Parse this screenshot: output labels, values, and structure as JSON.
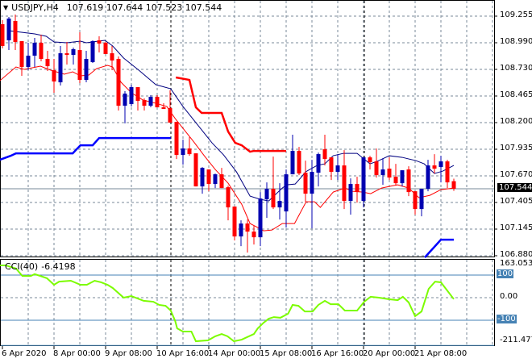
{
  "header": {
    "symbol": "USDJPY,H4",
    "ohlc": "107.619 107.644 107.523 107.544",
    "menu_icon": "triangle-down-icon"
  },
  "colors": {
    "bull": "#0000b0",
    "bear": "#ff0000",
    "ma_fast": "#ff0000",
    "ma_slow": "#000080",
    "cci": "#7cfc00",
    "level": "#4682b4",
    "grid": "#7a8a99"
  },
  "price_axis": {
    "ticks": [
      "109.255",
      "108.990",
      "108.730",
      "108.465",
      "108.200",
      "107.935",
      "107.670",
      "107.405",
      "107.145",
      "106.880"
    ],
    "current": "107.544"
  },
  "cci_panel": {
    "label": "CCI(40)",
    "value": "-6.4198",
    "max": "163.0533",
    "min": "-211.4777",
    "levels": [
      "100",
      "0.00",
      "-100"
    ]
  },
  "time_axis": {
    "labels": [
      "6 Apr 2020",
      "8 Apr 00:00",
      "9 Apr 08:00",
      "10 Apr 16:00",
      "14 Apr 00:00",
      "15 Apr 08:00",
      "16 Apr 16:00",
      "20 Apr 00:00",
      "21 Apr 08:00"
    ]
  },
  "chart_data": {
    "type": "candlestick",
    "symbol": "USDJPY",
    "timeframe": "H4",
    "ylim": [
      106.88,
      109.255
    ],
    "candles_ohlc": [
      [
        109.175,
        109.215,
        108.935,
        108.959
      ],
      [
        109.015,
        109.247,
        108.919,
        109.231
      ],
      [
        109.207,
        109.271,
        108.919,
        108.999
      ],
      [
        109.007,
        109.007,
        108.663,
        108.751
      ],
      [
        108.751,
        108.991,
        108.719,
        108.863
      ],
      [
        108.863,
        109.039,
        108.751,
        108.991
      ],
      [
        108.991,
        109.071,
        108.807,
        108.831
      ],
      [
        108.831,
        108.911,
        108.711,
        108.759
      ],
      [
        108.719,
        108.831,
        108.495,
        108.607
      ],
      [
        108.599,
        108.959,
        108.567,
        108.887
      ],
      [
        108.887,
        108.999,
        108.775,
        108.871
      ],
      [
        108.871,
        108.943,
        108.775,
        108.927
      ],
      [
        108.919,
        109.095,
        108.591,
        108.623
      ],
      [
        108.623,
        108.911,
        108.599,
        108.831
      ],
      [
        108.799,
        109.015,
        108.791,
        109.007
      ],
      [
        109.015,
        109.055,
        108.895,
        108.983
      ],
      [
        108.991,
        108.999,
        108.879,
        108.879
      ],
      [
        108.887,
        108.959,
        108.719,
        108.815
      ],
      [
        108.831,
        108.855,
        108.319,
        108.367
      ],
      [
        108.367,
        108.511,
        108.191,
        108.487
      ],
      [
        108.383,
        108.575,
        108.359,
        108.551
      ],
      [
        108.551,
        108.551,
        108.319,
        108.415
      ],
      [
        108.423,
        108.439,
        108.319,
        108.367
      ],
      [
        108.367,
        108.471,
        108.351,
        108.455
      ],
      [
        108.455,
        108.471,
        108.351,
        108.351
      ],
      [
        108.351,
        108.391,
        108.335,
        108.335
      ],
      [
        108.343,
        108.519,
        108.199,
        108.199
      ],
      [
        108.207,
        108.207,
        107.839,
        107.879
      ],
      [
        107.879,
        108.031,
        107.783,
        107.943
      ],
      [
        107.943,
        108.055,
        107.871,
        107.887
      ],
      [
        107.895,
        107.895,
        107.567,
        107.567
      ],
      [
        107.567,
        107.759,
        107.495,
        107.751
      ],
      [
        107.735,
        107.735,
        107.519,
        107.591
      ],
      [
        107.591,
        107.695,
        107.551,
        107.687
      ],
      [
        107.687,
        107.751,
        107.551,
        107.551
      ],
      [
        107.559,
        107.575,
        107.231,
        107.359
      ],
      [
        107.367,
        107.367,
        107.031,
        107.071
      ],
      [
        107.071,
        107.231,
        106.975,
        107.199
      ],
      [
        107.199,
        107.239,
        106.911,
        107.119
      ],
      [
        107.119,
        107.175,
        106.991,
        107.063
      ],
      [
        107.063,
        107.511,
        106.975,
        107.447
      ],
      [
        107.439,
        107.607,
        107.255,
        107.543
      ],
      [
        107.543,
        107.863,
        107.343,
        107.359
      ],
      [
        107.359,
        107.599,
        107.239,
        107.423
      ],
      [
        107.319,
        107.735,
        107.159,
        107.687
      ],
      [
        107.687,
        108.079,
        107.687,
        107.919
      ],
      [
        107.919,
        107.959,
        107.679,
        107.695
      ],
      [
        107.703,
        107.823,
        107.415,
        107.495
      ],
      [
        107.495,
        107.831,
        107.151,
        107.711
      ],
      [
        107.703,
        107.903,
        107.567,
        107.887
      ],
      [
        107.935,
        108.079,
        107.775,
        107.839
      ],
      [
        107.855,
        107.855,
        107.631,
        107.711
      ],
      [
        107.711,
        107.887,
        107.631,
        107.775
      ],
      [
        107.775,
        107.927,
        107.343,
        107.423
      ],
      [
        107.423,
        107.647,
        107.287,
        107.591
      ],
      [
        107.591,
        107.663,
        107.407,
        107.511
      ],
      [
        107.423,
        107.855,
        107.359,
        107.855
      ],
      [
        107.855,
        107.871,
        107.735,
        107.807
      ],
      [
        107.815,
        107.943,
        107.655,
        107.679
      ],
      [
        107.679,
        107.847,
        107.583,
        107.735
      ],
      [
        107.743,
        107.855,
        107.631,
        107.655
      ],
      [
        107.663,
        107.791,
        107.575,
        107.599
      ],
      [
        107.599,
        107.727,
        107.567,
        107.727
      ],
      [
        107.735,
        107.767,
        107.471,
        107.511
      ],
      [
        107.519,
        107.519,
        107.287,
        107.343
      ],
      [
        107.343,
        107.543,
        107.271,
        107.543
      ],
      [
        107.543,
        107.831,
        107.519,
        107.775
      ],
      [
        107.775,
        107.887,
        107.695,
        107.743
      ],
      [
        107.759,
        107.871,
        107.607,
        107.815
      ],
      [
        107.815,
        107.831,
        107.551,
        107.607
      ],
      [
        107.619,
        107.644,
        107.523,
        107.544
      ]
    ],
    "ma_slow": [
      [
        0.9,
        109.111
      ],
      [
        5,
        109.079
      ],
      [
        6.8,
        109.055
      ],
      [
        8,
        108.999
      ],
      [
        10,
        108.991
      ],
      [
        12.1,
        109.007
      ],
      [
        13,
        108.991
      ],
      [
        15.9,
        109.015
      ],
      [
        17.1,
        108.959
      ],
      [
        18.8,
        108.839
      ],
      [
        21.3,
        108.711
      ],
      [
        23.8,
        108.575
      ],
      [
        26.1,
        108.535
      ],
      [
        28,
        108.359
      ],
      [
        30.5,
        108.159
      ],
      [
        32.5,
        107.999
      ],
      [
        34.3,
        107.879
      ],
      [
        36.3,
        107.711
      ],
      [
        38.4,
        107.471
      ],
      [
        40,
        107.439
      ],
      [
        41.3,
        107.423
      ],
      [
        43.4,
        107.551
      ],
      [
        44.1,
        107.583
      ],
      [
        45.4,
        107.591
      ],
      [
        46.3,
        107.655
      ],
      [
        47,
        107.711
      ],
      [
        48.8,
        107.775
      ],
      [
        50,
        107.791
      ],
      [
        51.3,
        107.871
      ],
      [
        52.9,
        107.895
      ],
      [
        55,
        107.895
      ],
      [
        57,
        107.791
      ],
      [
        58.1,
        107.815
      ],
      [
        60,
        107.871
      ],
      [
        62,
        107.855
      ],
      [
        64.1,
        107.823
      ],
      [
        65.4,
        107.791
      ],
      [
        67,
        107.695
      ],
      [
        68.3,
        107.719
      ],
      [
        70,
        107.775
      ]
    ],
    "ma_fast": [
      [
        -0.4,
        108.615
      ],
      [
        2.1,
        108.751
      ],
      [
        3.4,
        108.727
      ],
      [
        5.9,
        108.759
      ],
      [
        7.5,
        108.719
      ],
      [
        9.6,
        108.679
      ],
      [
        10.9,
        108.703
      ],
      [
        12.1,
        108.663
      ],
      [
        13.4,
        108.671
      ],
      [
        14.6,
        108.735
      ],
      [
        16.3,
        108.767
      ],
      [
        17.1,
        108.751
      ],
      [
        18.4,
        108.599
      ],
      [
        20,
        108.495
      ],
      [
        21.8,
        108.423
      ],
      [
        23.8,
        108.391
      ],
      [
        25.5,
        108.359
      ],
      [
        26.8,
        108.239
      ],
      [
        28.4,
        108.111
      ],
      [
        29.6,
        108.015
      ],
      [
        31.3,
        107.871
      ],
      [
        33,
        107.735
      ],
      [
        35,
        107.599
      ],
      [
        37.1,
        107.391
      ],
      [
        38.4,
        107.199
      ],
      [
        39.6,
        107.159
      ],
      [
        40.5,
        107.127
      ],
      [
        41.8,
        107.135
      ],
      [
        43.4,
        107.199
      ],
      [
        45.3,
        107.199
      ],
      [
        47.1,
        107.415
      ],
      [
        48.4,
        107.415
      ],
      [
        49.3,
        107.359
      ],
      [
        51.3,
        107.511
      ],
      [
        53.1,
        107.551
      ],
      [
        54.3,
        107.519
      ],
      [
        55.9,
        107.511
      ],
      [
        57.1,
        107.495
      ],
      [
        58.8,
        107.551
      ],
      [
        60.6,
        107.575
      ],
      [
        61.3,
        107.583
      ],
      [
        63,
        107.551
      ],
      [
        64.6,
        107.455
      ],
      [
        66.3,
        107.479
      ],
      [
        68,
        107.535
      ],
      [
        70,
        107.551
      ]
    ],
    "channel_upper": [
      [
        26.9,
        108.647
      ],
      [
        29,
        108.623
      ],
      [
        30,
        108.351
      ],
      [
        30.9,
        108.295
      ],
      [
        34,
        108.295
      ],
      [
        35,
        108.111
      ],
      [
        36.1,
        107.999
      ],
      [
        37.1,
        107.975
      ],
      [
        38.4,
        107.911
      ],
      [
        39,
        107.919
      ],
      [
        44,
        107.919
      ]
    ],
    "channel_lower": [
      [
        [
          -0.4,
          107.831
        ],
        [
          1.3,
          107.871
        ],
        [
          2.1,
          107.895
        ],
        [
          10.9,
          107.895
        ],
        [
          12.1,
          107.975
        ],
        [
          14,
          107.975
        ],
        [
          15,
          108.047
        ],
        [
          26.1,
          108.047
        ]
      ],
      [
        [
          65.5,
          106.863
        ],
        [
          68,
          107.039
        ],
        [
          70,
          107.039
        ]
      ]
    ],
    "cci": [
      [
        -0.4,
        143
      ],
      [
        0.5,
        143
      ],
      [
        2.1,
        129
      ],
      [
        3.1,
        96
      ],
      [
        4.4,
        96
      ],
      [
        5,
        104
      ],
      [
        5.9,
        96
      ],
      [
        6.9,
        86
      ],
      [
        8,
        57
      ],
      [
        8.8,
        71
      ],
      [
        10.6,
        75
      ],
      [
        12.1,
        57
      ],
      [
        13.1,
        57
      ],
      [
        14.3,
        75
      ],
      [
        15.3,
        68
      ],
      [
        16.3,
        57
      ],
      [
        17.1,
        43
      ],
      [
        18.8,
        0
      ],
      [
        20,
        7
      ],
      [
        21.9,
        -14
      ],
      [
        23.4,
        -18
      ],
      [
        24.3,
        -32
      ],
      [
        25.3,
        -36
      ],
      [
        26.1,
        -57
      ],
      [
        26.8,
        -104
      ],
      [
        27.1,
        -136
      ],
      [
        28,
        -150
      ],
      [
        29.3,
        -150
      ],
      [
        30,
        -193
      ],
      [
        31.9,
        -189
      ],
      [
        33,
        -171
      ],
      [
        34,
        -161
      ],
      [
        34.9,
        -171
      ],
      [
        35.9,
        -193
      ],
      [
        37.1,
        -186
      ],
      [
        39,
        -161
      ],
      [
        39.6,
        -136
      ],
      [
        40.5,
        -111
      ],
      [
        41.3,
        -93
      ],
      [
        42.1,
        -86
      ],
      [
        43.1,
        -89
      ],
      [
        44.3,
        -71
      ],
      [
        45,
        -32
      ],
      [
        45.9,
        -36
      ],
      [
        46.9,
        -61
      ],
      [
        48.1,
        -61
      ],
      [
        49,
        -32
      ],
      [
        50,
        -14
      ],
      [
        50.9,
        -29
      ],
      [
        52.1,
        -29
      ],
      [
        53.1,
        -57
      ],
      [
        55,
        -57
      ],
      [
        56.1,
        -18
      ],
      [
        57.1,
        4
      ],
      [
        58.4,
        0
      ],
      [
        60,
        -7
      ],
      [
        61.3,
        -11
      ],
      [
        62.1,
        4
      ],
      [
        63,
        -21
      ],
      [
        64,
        -82
      ],
      [
        65,
        -61
      ],
      [
        66.1,
        39
      ],
      [
        67.1,
        71
      ],
      [
        68,
        68
      ],
      [
        70,
        -6.4198
      ]
    ],
    "cci_ylim": [
      -211.4777,
      163.0533
    ],
    "period_separators_candle_index": [
      26.1,
      56.1
    ]
  }
}
